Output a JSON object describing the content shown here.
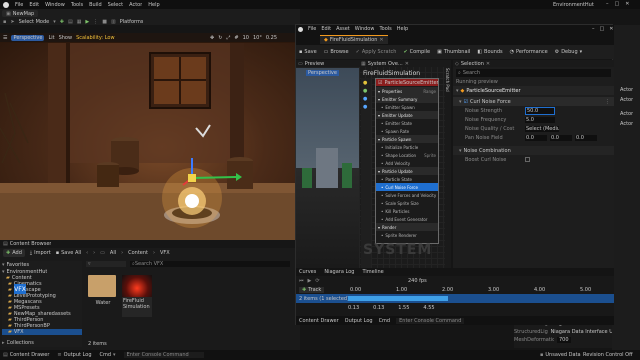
{
  "menubar": {
    "items": [
      "File",
      "Edit",
      "Window",
      "Tools",
      "Build",
      "Select",
      "Actor",
      "Help"
    ],
    "project": "EnvironmentHut"
  },
  "editor_tab": {
    "label": "NewMap"
  },
  "toolbar": {
    "select_mode": "Select Mode",
    "platforms": "Platforms"
  },
  "viewport": {
    "perspective": "Perspective",
    "lit": "Lit",
    "show": "Show",
    "scalability": "Scalability: Low",
    "grid": "10",
    "angle": "10°",
    "scale": "0.25"
  },
  "content_browser": {
    "title": "Content Browser",
    "add": "Add",
    "import": "Import",
    "save_all": "Save All",
    "breadcrumb": [
      "All",
      "Content",
      "VFX"
    ],
    "filter_label": "Favorites",
    "search_placeholder": "Search VFX",
    "tree_root": "EnvironmentHut",
    "tree_items": [
      "Content",
      "Cinematics",
      "Landscape",
      "LevelPrototyping",
      "Megascans",
      "MSPresets",
      "NewMap_sharedassets",
      "ThirdPerson",
      "ThirdPersonBP",
      "VFX"
    ],
    "selected_folder": "VFX",
    "collections": "Collections",
    "assets": [
      {
        "name": "Water",
        "kind": "folder"
      },
      {
        "name": "FireFluid Simulation",
        "kind": "niagara"
      }
    ],
    "item_count": "2 items"
  },
  "niagara": {
    "tab": "FireFluidSimulation",
    "menu": [
      "File",
      "Edit",
      "Asset",
      "Window",
      "Tools",
      "Help"
    ],
    "toolbar": [
      "Save",
      "Browse",
      "Apply Scratch",
      "Compile",
      "Thumbnail",
      "Bounds",
      "Performance",
      "Debug"
    ],
    "preview_tab": "Preview",
    "system_tab": "System Ove...",
    "scratch_tab": "Scratch Pad",
    "selection_tab": "Selection",
    "viewport_label": "Perspective",
    "graph_title": "FireFluidSimulation",
    "emitter_name": "ParticleSourceEmitter",
    "stack": [
      {
        "label": "Properties",
        "kind": "group"
      },
      {
        "label": "Emitter Summary",
        "kind": "group"
      },
      {
        "label": "Emitter Spawn",
        "kind": "item"
      },
      {
        "label": "Emitter Update",
        "kind": "group"
      },
      {
        "label": "Emitter State",
        "kind": "item"
      },
      {
        "label": "Spawn Rate",
        "kind": "item"
      },
      {
        "label": "Particle Spawn",
        "kind": "group"
      },
      {
        "label": "Initialize Particle",
        "kind": "item"
      },
      {
        "label": "Shape Location",
        "kind": "item"
      },
      {
        "label": "Add Velocity",
        "kind": "item"
      },
      {
        "label": "Particle Update",
        "kind": "group"
      },
      {
        "label": "Particle State",
        "kind": "item"
      },
      {
        "label": "Curl Noise Force",
        "kind": "selected"
      },
      {
        "label": "Solve Forces and Velocity",
        "kind": "item"
      },
      {
        "label": "Scale Sprite Size",
        "kind": "item"
      },
      {
        "label": "Kill Particles",
        "kind": "item"
      },
      {
        "label": "Add Event Generator",
        "kind": "item"
      },
      {
        "label": "Render",
        "kind": "group"
      },
      {
        "label": "Sprite Renderer",
        "kind": "item"
      }
    ],
    "stack_tags": {
      "sprite": "Sprite",
      "range": "Range"
    },
    "system_watermark": "SYSTEM",
    "selection": {
      "search_placeholder": "Search",
      "status": "Running preview",
      "emitter": "ParticleSourceEmitter",
      "module": "Curl Noise Force",
      "params": [
        {
          "label": "Noise Strength",
          "value": "50.0"
        },
        {
          "label": "Noise Frequency",
          "value": "5.0"
        },
        {
          "label": "Noise Quality / Cost",
          "value": "Select (Medium)"
        },
        {
          "label": "Pan Noise Field",
          "value": "0.0"
        }
      ],
      "pan_values": [
        "0.0",
        "0.0",
        "0.0"
      ],
      "section2": "Noise Combination",
      "param2": "Boost Curl Noise"
    },
    "timeline": {
      "curves_tab": "Curves",
      "log_tab": "Niagara Log",
      "timeline_tab": "Timeline",
      "track": "Track",
      "fps": "240 fps",
      "items_label": "2 items (1 selected)",
      "ruler": [
        "0.00",
        "1.00",
        "2.00",
        "3.00",
        "4.00",
        "5.00"
      ],
      "time_values": [
        "0.13",
        "0.13",
        "1.55",
        "4.55"
      ]
    },
    "drawer_tabs": [
      "Content Drawer",
      "Output Log",
      "Cmd",
      "Enter Console Command"
    ]
  },
  "details": {
    "rows": [
      {
        "label": "StructuredLightE",
        "value": "Niagara Data Interface UserS"
      },
      {
        "label": "StructuredLightE",
        "value": "Niagara Data Interface UserS"
      },
      {
        "label": "MeshDeformation",
        "value": "700"
      }
    ]
  },
  "right_rail": {
    "items": [
      "Actor",
      "Actor",
      "Actor",
      "Actor"
    ]
  },
  "status": {
    "content_drawer": "Content Drawer",
    "output_log": "Output Log",
    "cmd": "Cmd",
    "console_placeholder": "Enter Console Command",
    "unsaved": "Unsaved Data",
    "revision": "Revision Control Off"
  },
  "colors": {
    "accent_orange": "#f39a1e",
    "select_blue": "#1b6fd0",
    "fire": "#ffcc66",
    "emitter_header": "#8a1d1d"
  }
}
